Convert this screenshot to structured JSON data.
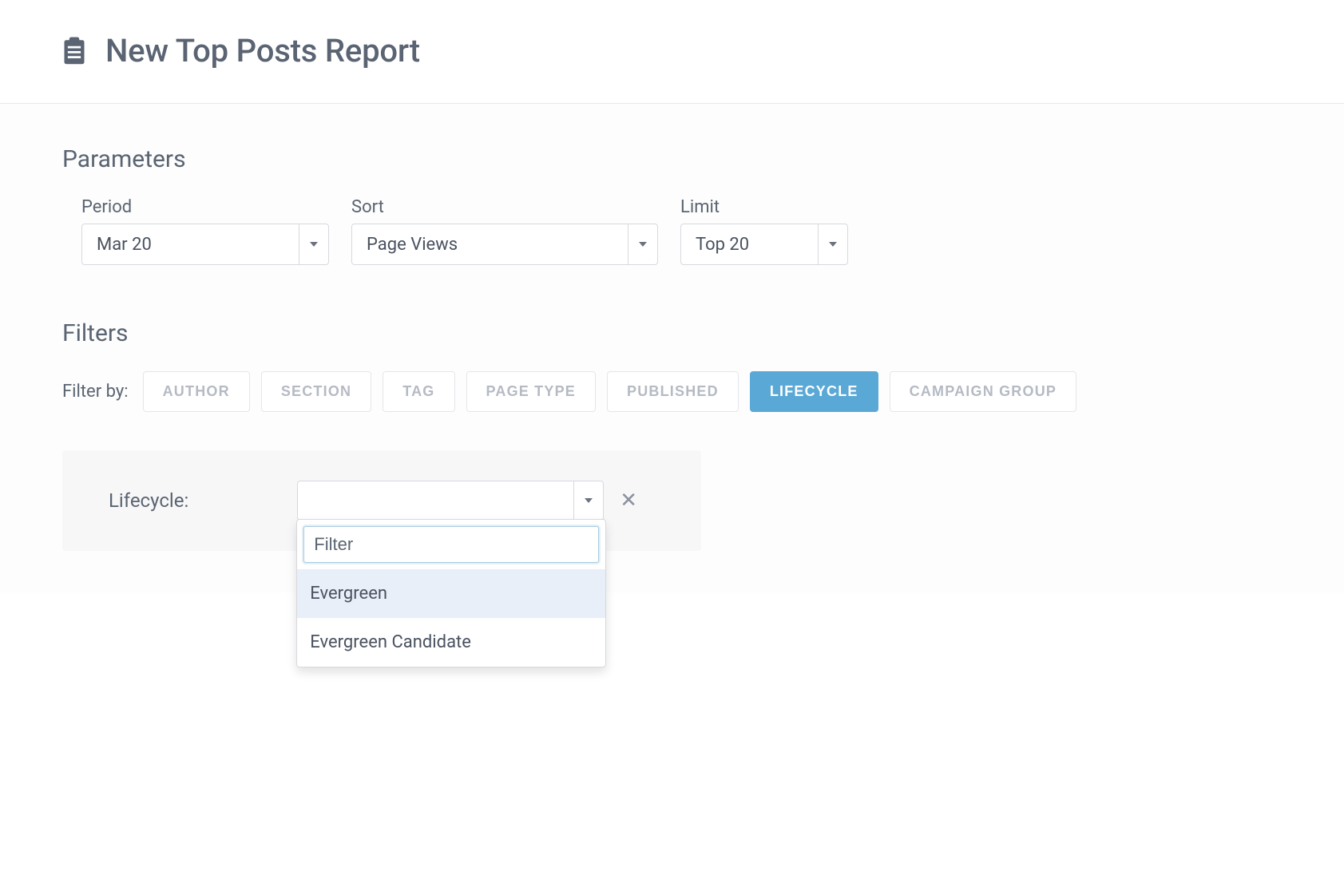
{
  "header": {
    "title": "New Top Posts Report"
  },
  "parameters": {
    "title": "Parameters",
    "period": {
      "label": "Period",
      "value": "Mar 20"
    },
    "sort": {
      "label": "Sort",
      "value": "Page Views"
    },
    "limit": {
      "label": "Limit",
      "value": "Top 20"
    }
  },
  "filters": {
    "title": "Filters",
    "filter_by_label": "Filter by:",
    "tabs": [
      {
        "label": "AUTHOR",
        "active": false
      },
      {
        "label": "SECTION",
        "active": false
      },
      {
        "label": "TAG",
        "active": false
      },
      {
        "label": "PAGE TYPE",
        "active": false
      },
      {
        "label": "PUBLISHED",
        "active": false
      },
      {
        "label": "LIFECYCLE",
        "active": true
      },
      {
        "label": "CAMPAIGN GROUP",
        "active": false
      }
    ],
    "panel": {
      "label": "Lifecycle:",
      "value": "",
      "dropdown": {
        "placeholder": "Filter",
        "options": [
          {
            "label": "Evergreen",
            "highlighted": true
          },
          {
            "label": "Evergreen Candidate",
            "highlighted": false
          }
        ]
      }
    }
  }
}
